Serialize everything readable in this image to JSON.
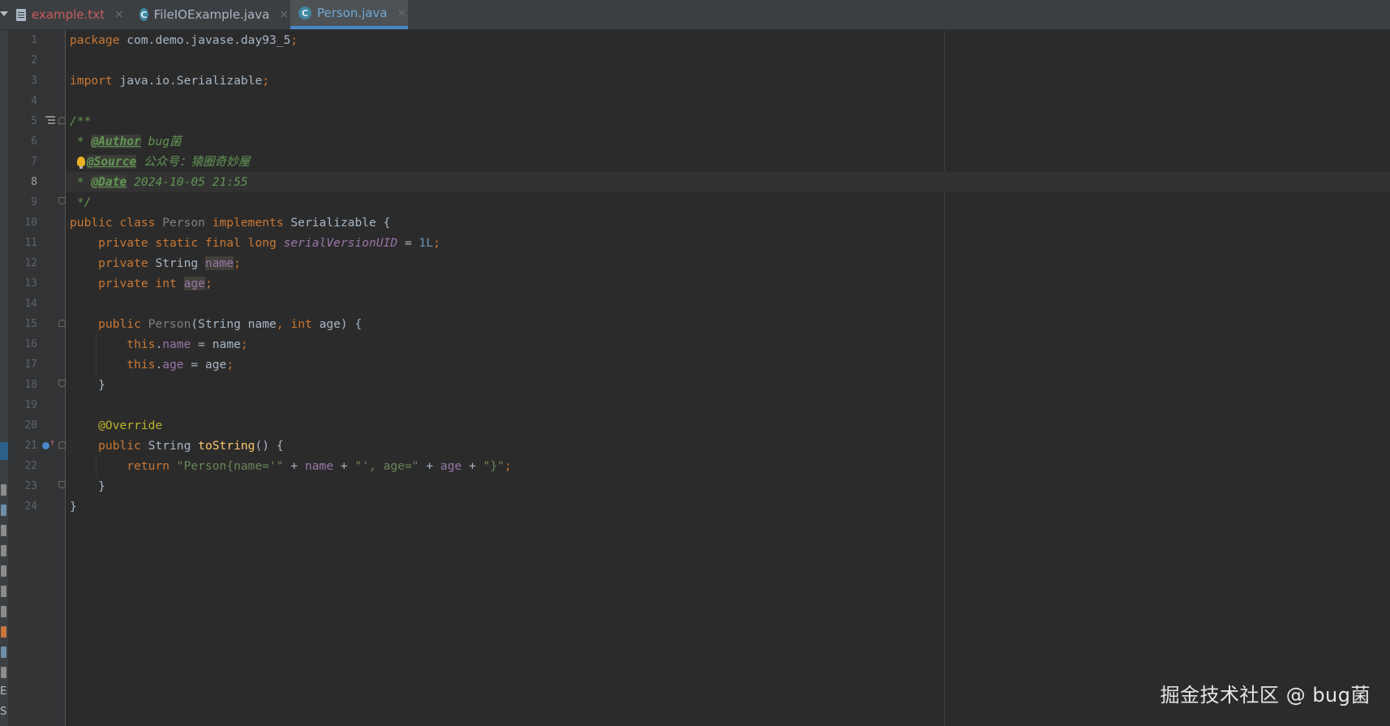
{
  "tabs": [
    {
      "label": "example.txt",
      "icon": "text-file-icon",
      "color": "#cc5c5c"
    },
    {
      "label": "FileIOExample.java",
      "icon": "java-class-icon",
      "color": "#a9b7c6"
    },
    {
      "label": "Person.java",
      "icon": "java-class-icon",
      "color": "#6fa9d6",
      "active": true
    }
  ],
  "close_glyph": "×",
  "line_numbers": [
    "1",
    "2",
    "3",
    "4",
    "5",
    "6",
    "7",
    "8",
    "9",
    "10",
    "11",
    "12",
    "13",
    "14",
    "15",
    "16",
    "17",
    "18",
    "19",
    "20",
    "21",
    "22",
    "23",
    "24"
  ],
  "current_line": 8,
  "code": {
    "l1": {
      "kw": "package",
      "rest": " com.demo.javase.day93_5",
      "semi": ";"
    },
    "l3": {
      "kw": "import",
      "rest": " java.io.Serializable",
      "semi": ";"
    },
    "l5": {
      "text": "/**"
    },
    "l6": {
      "prefix": " * ",
      "tag": "@Author",
      "value": " bug菌"
    },
    "l7": {
      "tag": "@Source",
      "value": " 公众号：猿圈奇妙屋"
    },
    "l8": {
      "prefix": " * ",
      "tag": "@Date",
      "value": " 2024-10-05 21:55"
    },
    "l9": {
      "text": " */"
    },
    "l10": {
      "kw1": "public class",
      "name": " Person",
      "kw2": " implements",
      "rest": " Serializable {"
    },
    "l11": {
      "kw": "    private static final long",
      "field": " serialVersionUID",
      "eq": " = ",
      "num": "1L",
      "semi": ";"
    },
    "l12": {
      "kw": "    private",
      "type": " String ",
      "field": "name",
      "semi": ";"
    },
    "l13": {
      "kw": "    private int",
      "sp": " ",
      "field": "age",
      "semi": ";"
    },
    "l15": {
      "kw": "    public",
      "name": " Person",
      "p1": "(String name",
      "comma": ",",
      "kw2": " int",
      "p2": " age) {"
    },
    "l16": {
      "kw": "        this",
      "dot": ".",
      "field": "name",
      "rest": " = name",
      "semi": ";"
    },
    "l17": {
      "kw": "        this",
      "dot": ".",
      "field": "age",
      "rest": " = age",
      "semi": ";"
    },
    "l18": {
      "text": "    }"
    },
    "l20": {
      "annot": "    @Override"
    },
    "l21": {
      "kw": "    public",
      "type": " String ",
      "method": "toString",
      "rest": "() {"
    },
    "l22": {
      "kw": "        return",
      "s1": " \"Person{name='\"",
      "op1": " + ",
      "f1": "name",
      "op2": " + ",
      "s2": "\"', age=\"",
      "op3": " + ",
      "f2": "age",
      "op4": " + ",
      "s3": "\"}\"",
      "semi": ";"
    },
    "l23": {
      "text": "    }"
    },
    "l24": {
      "text": "}"
    }
  },
  "watermark": "掘金技术社区 @ bug菌",
  "strip_letters": [
    "E",
    "S"
  ],
  "colors": {
    "background": "#2b2b2b",
    "keyword": "#cc7832",
    "string": "#6a8759",
    "number": "#6897bb",
    "field": "#9876aa",
    "method": "#ffc66d",
    "annotation": "#bbb529",
    "javadoc": "#629755",
    "active_tab_underline": "#4a88c7"
  }
}
